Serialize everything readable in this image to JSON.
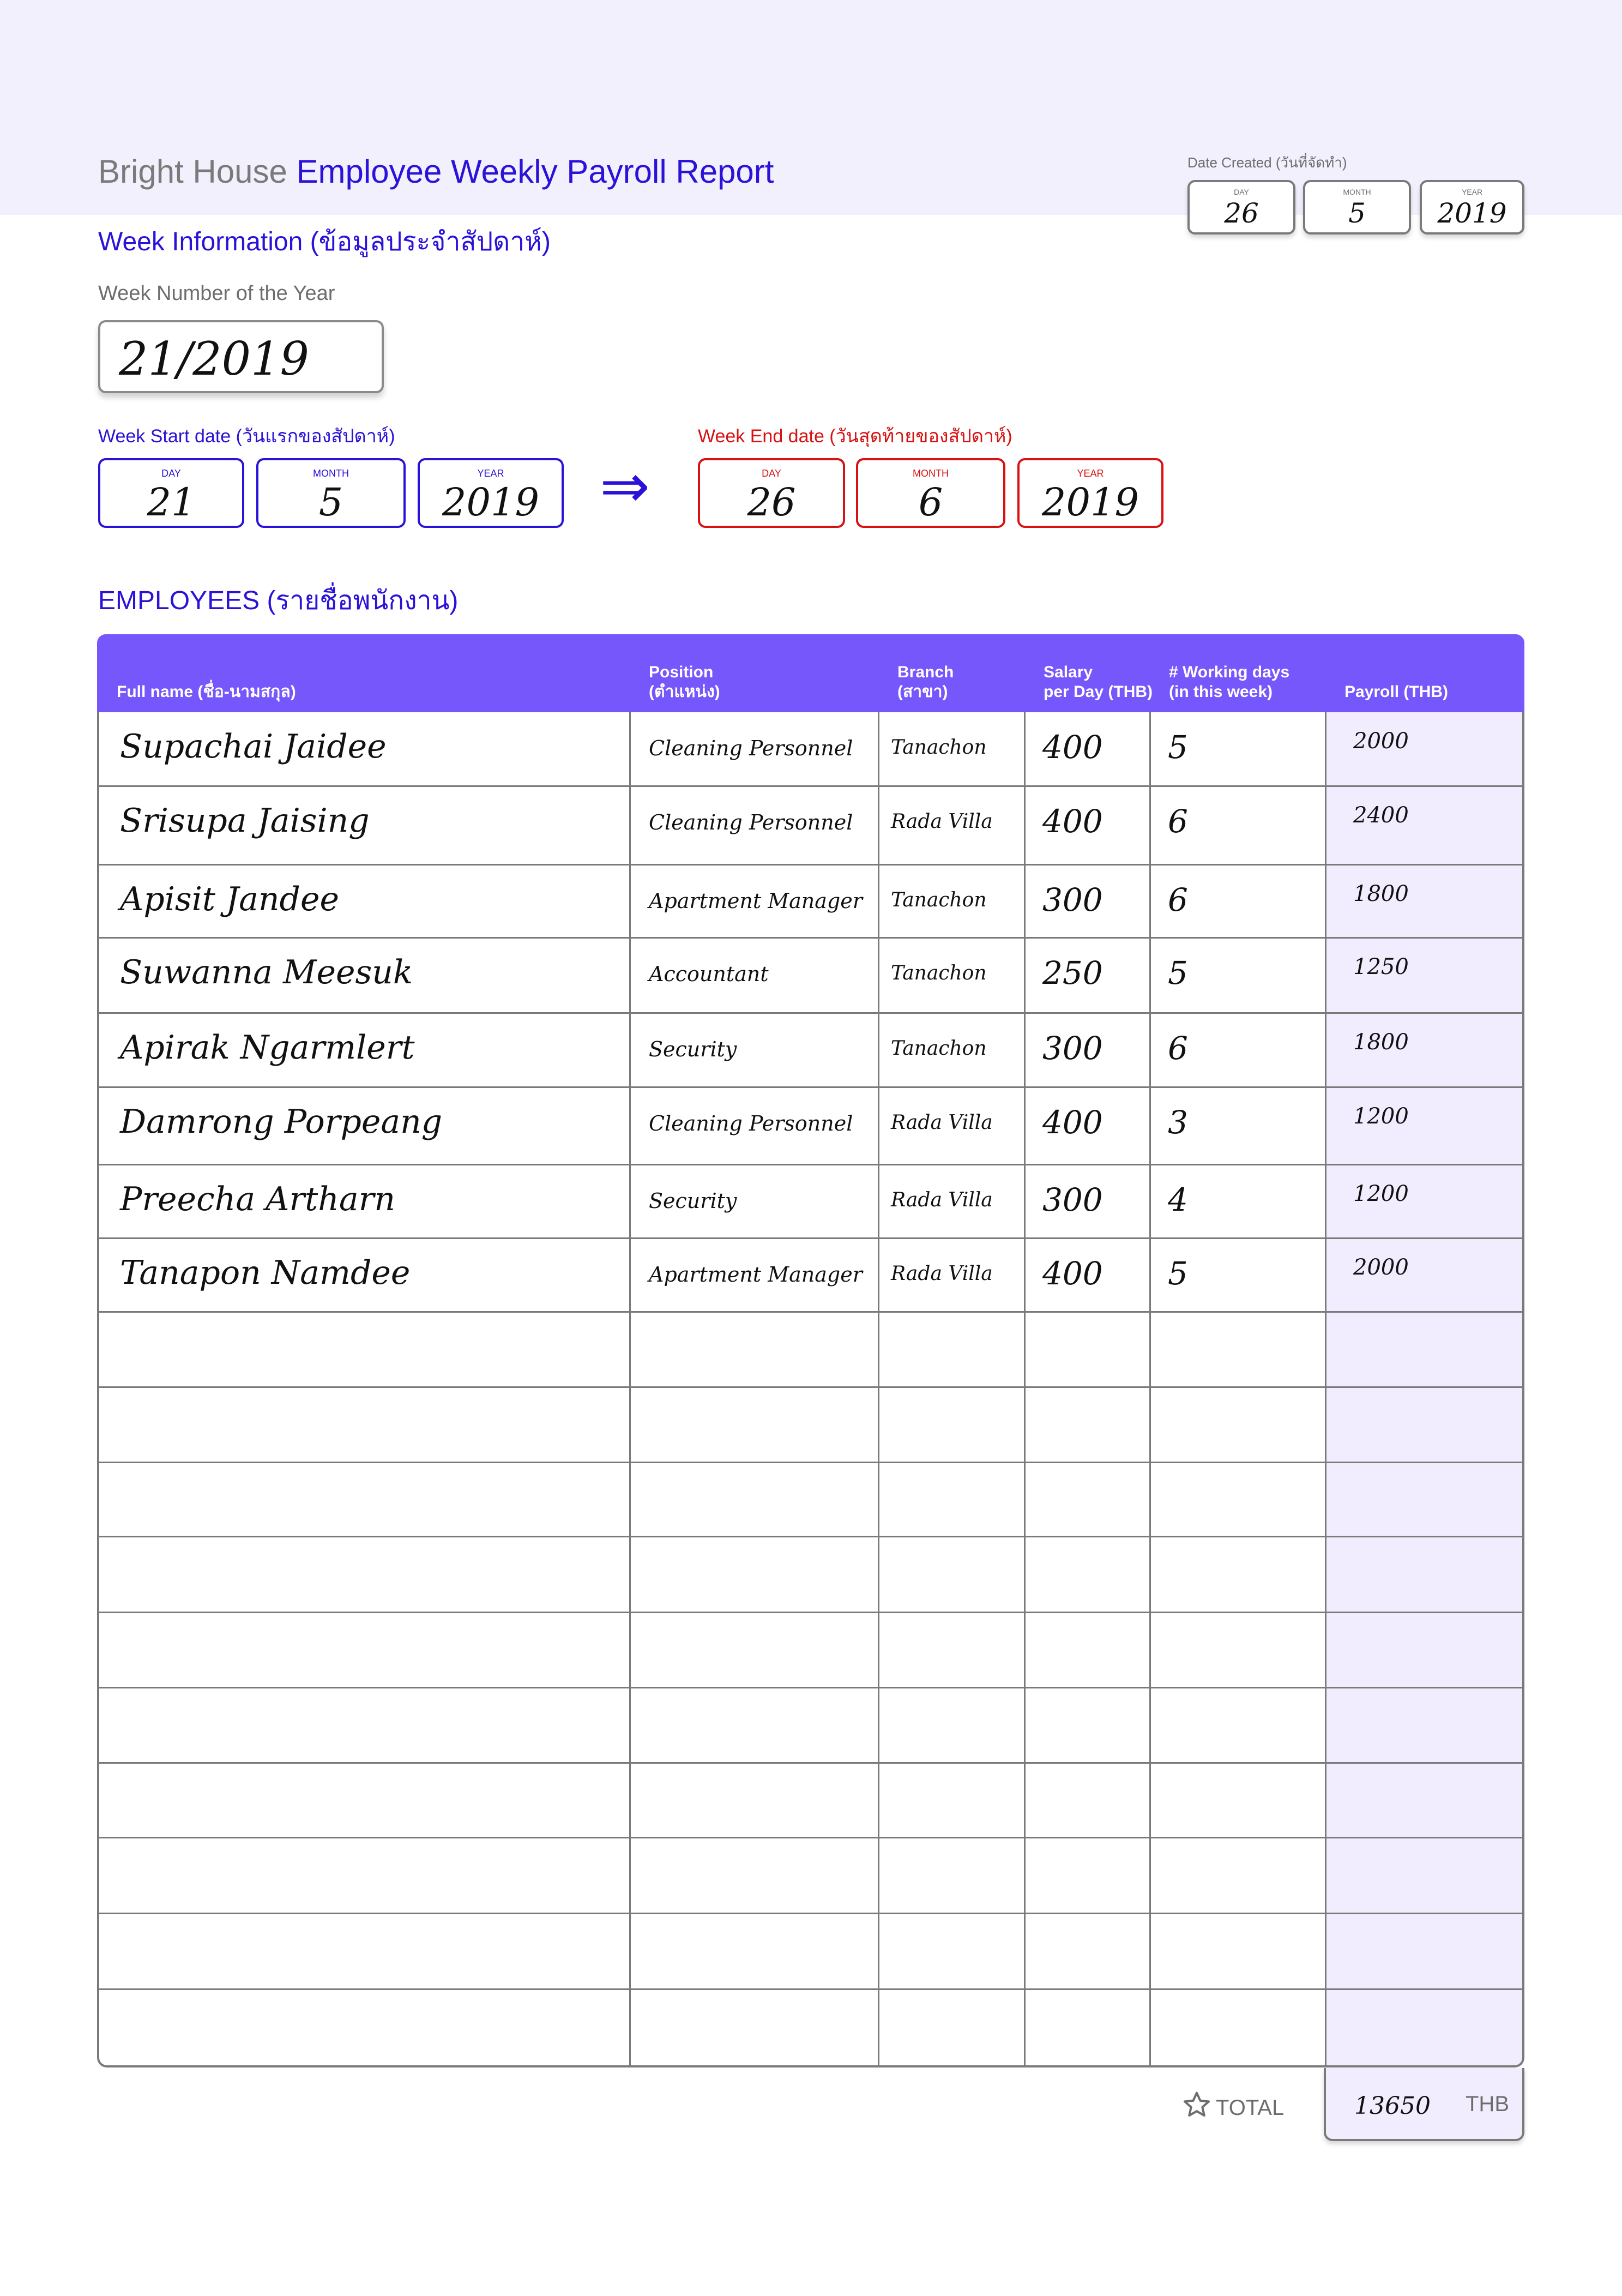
{
  "header": {
    "brand": "Bright House",
    "title": "Employee Weekly Payroll Report"
  },
  "date_created": {
    "label": "Date Created (วันที่จัดทำ)",
    "day_caption": "DAY",
    "month_caption": "MONTH",
    "year_caption": "YEAR",
    "day": "26",
    "month": "5",
    "year": "2019"
  },
  "week_info": {
    "heading": "Week Information (ข้อมูลประจำสัปดาห์)",
    "week_number_label": "Week Number of the Year",
    "week_number": "21/2019",
    "start": {
      "label": "Week Start date (วันแรกของสัปดาห์)",
      "day_caption": "DAY",
      "month_caption": "MONTH",
      "year_caption": "YEAR",
      "day": "21",
      "month": "5",
      "year": "2019"
    },
    "arrow": "⇒",
    "end": {
      "label": "Week End date (วันสุดท้ายของสัปดาห์)",
      "day_caption": "DAY",
      "month_caption": "MONTH",
      "year_caption": "YEAR",
      "day": "26",
      "month": "6",
      "year": "2019"
    }
  },
  "employees": {
    "heading": "EMPLOYEES (รายชื่อพนักงาน)",
    "columns": {
      "name": "Full name (ชื่อ-นามสกุล)",
      "position_1": "Position",
      "position_2": "(ตำแหน่ง)",
      "branch_1": "Branch",
      "branch_2": "(สาขา)",
      "salary_1": "Salary",
      "salary_2": "per Day (THB)",
      "days_1": "# Working days",
      "days_2": "(in this week)",
      "payroll": "Payroll (THB)"
    },
    "rows": [
      {
        "name": "Supachai Jaidee",
        "position": "Cleaning Personnel",
        "branch": "Tanachon",
        "salary": "400",
        "days": "5",
        "payroll": "2000"
      },
      {
        "name": "Srisupa Jaising",
        "position": "Cleaning Personnel",
        "branch": "Rada Villa",
        "salary": "400",
        "days": "6",
        "payroll": "2400"
      },
      {
        "name": "Apisit Jandee",
        "position": "Apartment Manager",
        "branch": "Tanachon",
        "salary": "300",
        "days": "6",
        "payroll": "1800"
      },
      {
        "name": "Suwanna Meesuk",
        "position": "Accountant",
        "branch": "Tanachon",
        "salary": "250",
        "days": "5",
        "payroll": "1250"
      },
      {
        "name": "Apirak Ngarmlert",
        "position": "Security",
        "branch": "Tanachon",
        "salary": "300",
        "days": "6",
        "payroll": "1800"
      },
      {
        "name": "Damrong Porpeang",
        "position": "Cleaning Personnel",
        "branch": "Rada Villa",
        "salary": "400",
        "days": "3",
        "payroll": "1200"
      },
      {
        "name": "Preecha Artharn",
        "position": "Security",
        "branch": "Rada Villa",
        "salary": "300",
        "days": "4",
        "payroll": "1200"
      },
      {
        "name": "Tanapon  Namdee",
        "position": "Apartment Manager",
        "branch": "Rada Villa",
        "salary": "400",
        "days": "5",
        "payroll": "2000"
      }
    ]
  },
  "total": {
    "icon": "star-outline-icon",
    "label": "TOTAL",
    "value": "13650",
    "currency": "THB"
  },
  "colors": {
    "accent_blue": "#2a12d8",
    "header_purple": "#7657fc",
    "end_date_red": "#d81212",
    "payroll_fill": "#f1edfe",
    "top_band": "#f1f0fc"
  }
}
